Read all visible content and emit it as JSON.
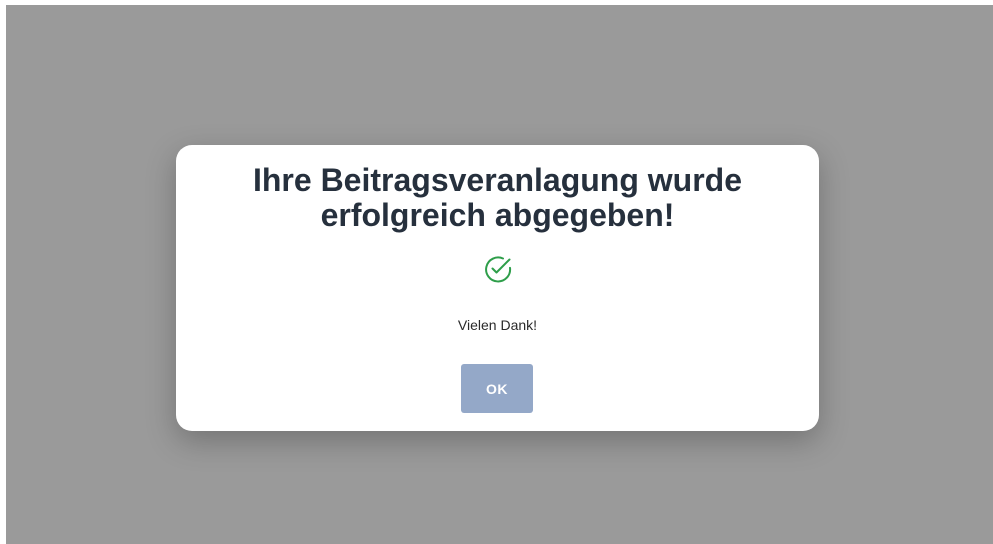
{
  "modal": {
    "title": "Ihre Beitragsveranlagung wurde erfolgreich abgegeben!",
    "icon": "check-circle-icon",
    "message": "Vielen Dank!",
    "ok_label": "OK"
  },
  "colors": {
    "overlay": "#9a9a9a",
    "title": "#26303d",
    "success_icon": "#2e9e4a",
    "button_bg": "#94a8c8",
    "button_text": "#ffffff"
  }
}
